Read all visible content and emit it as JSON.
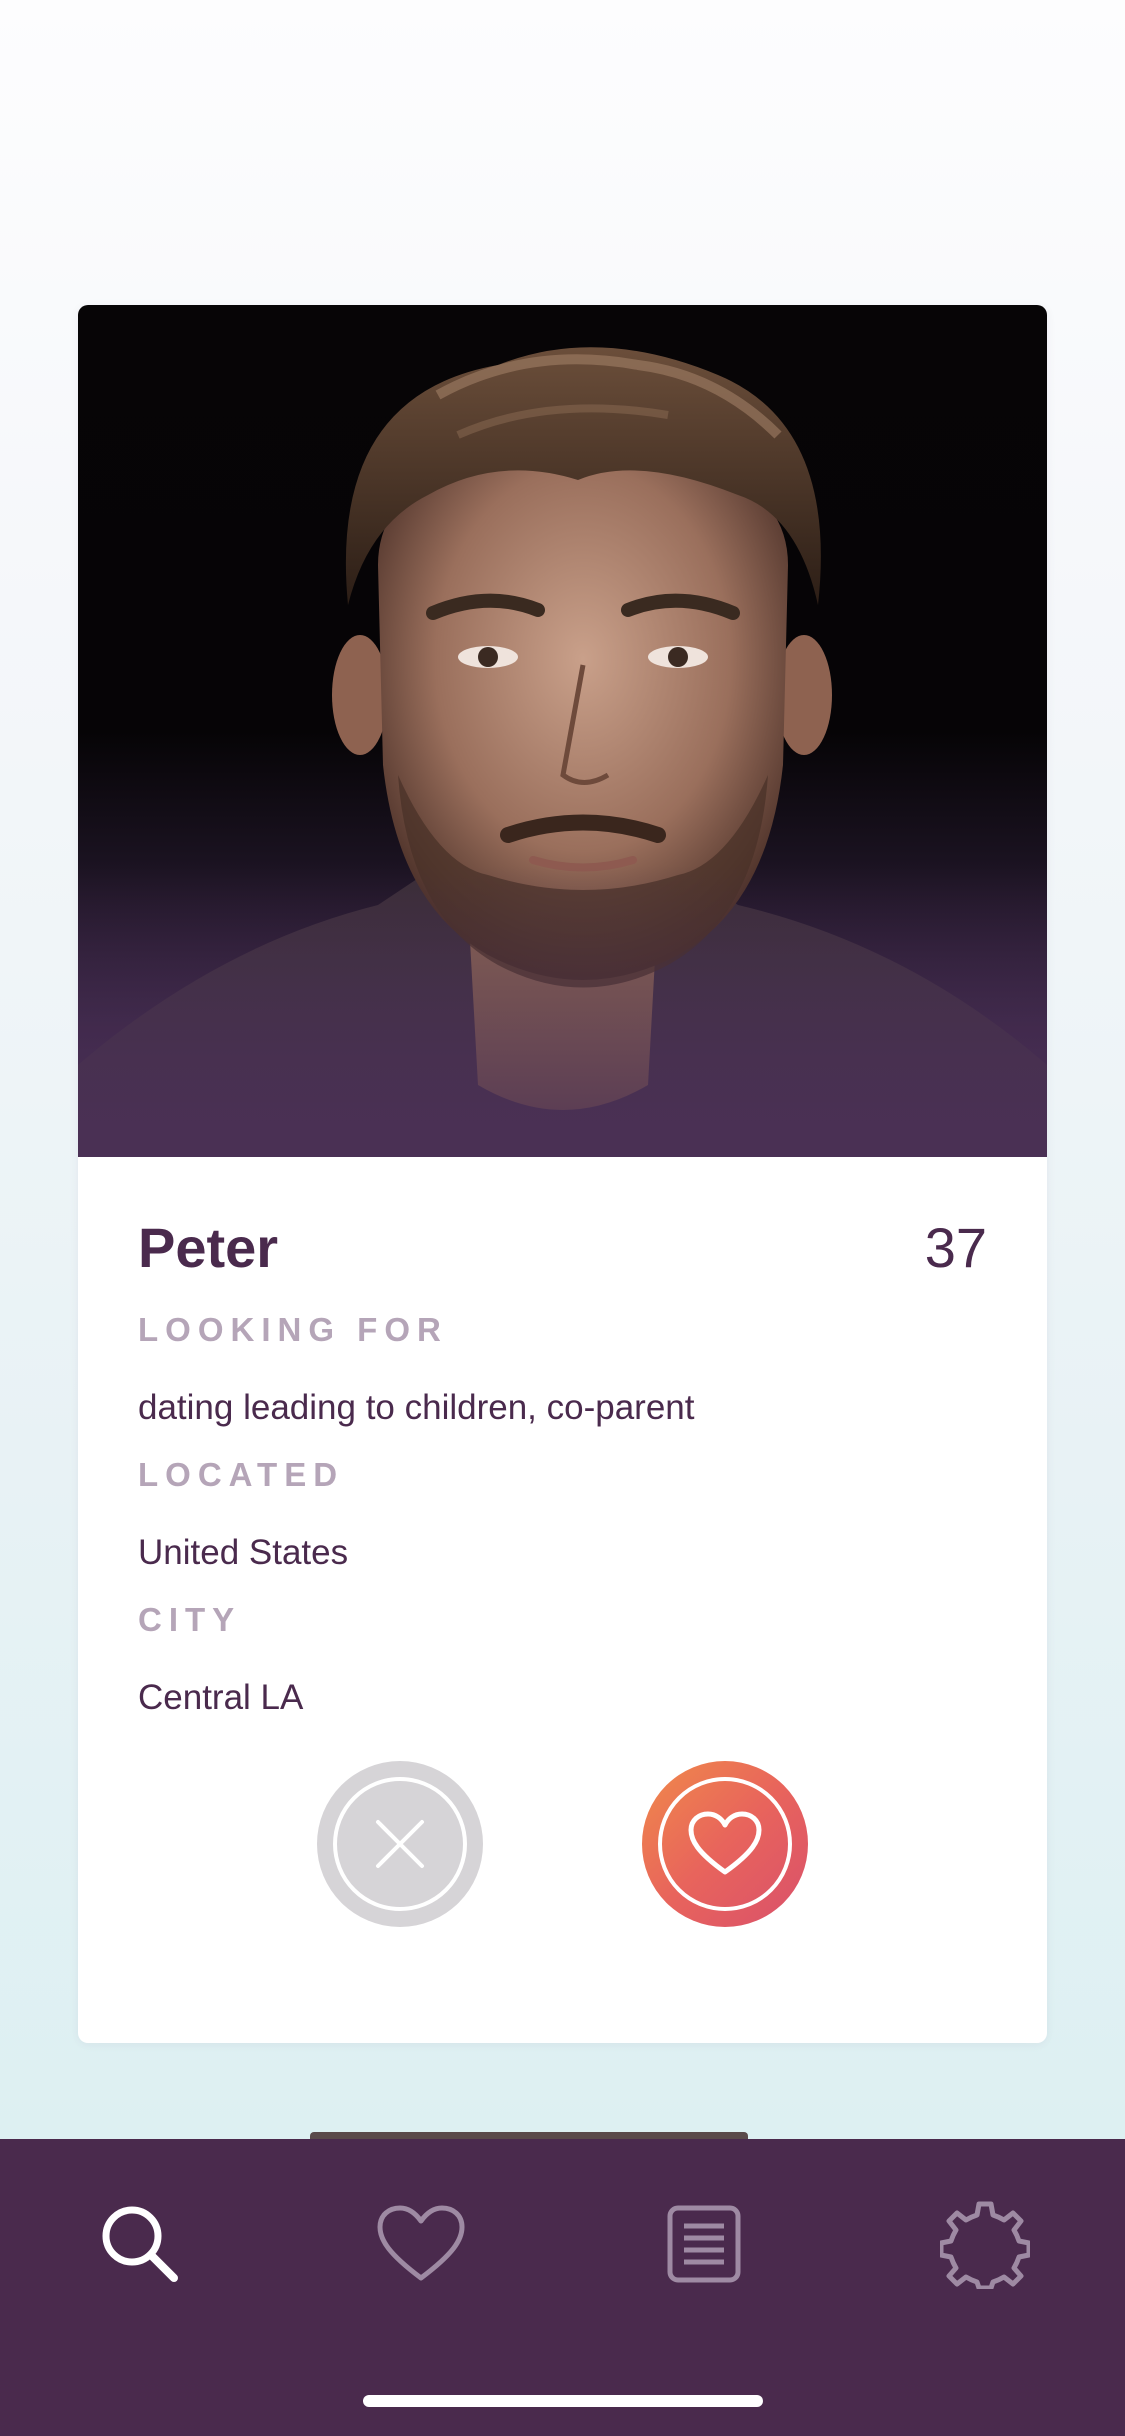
{
  "profile": {
    "name": "Peter",
    "age": "37",
    "photo_alt": "profile-photo"
  },
  "details": {
    "looking_for_label": "LOOKING FOR",
    "looking_for_value": "dating leading to children, co-parent",
    "located_label": "LOCATED",
    "located_value": "United States",
    "city_label": "CITY",
    "city_value": "Central LA"
  },
  "actions": {
    "dislike_icon": "close-icon",
    "like_icon": "heart-icon"
  },
  "tabbar": {
    "items": [
      {
        "icon": "search-icon",
        "active": true
      },
      {
        "icon": "heart-icon",
        "active": false
      },
      {
        "icon": "list-icon",
        "active": false
      },
      {
        "icon": "gear-icon",
        "active": false
      }
    ]
  },
  "colors": {
    "brand_purple": "#4a2a4d",
    "label_grey": "#b5a5b8",
    "like_gradient_start": "#f08a4a",
    "like_gradient_end": "#d9506b",
    "dislike_grey": "#d6d4d7"
  }
}
